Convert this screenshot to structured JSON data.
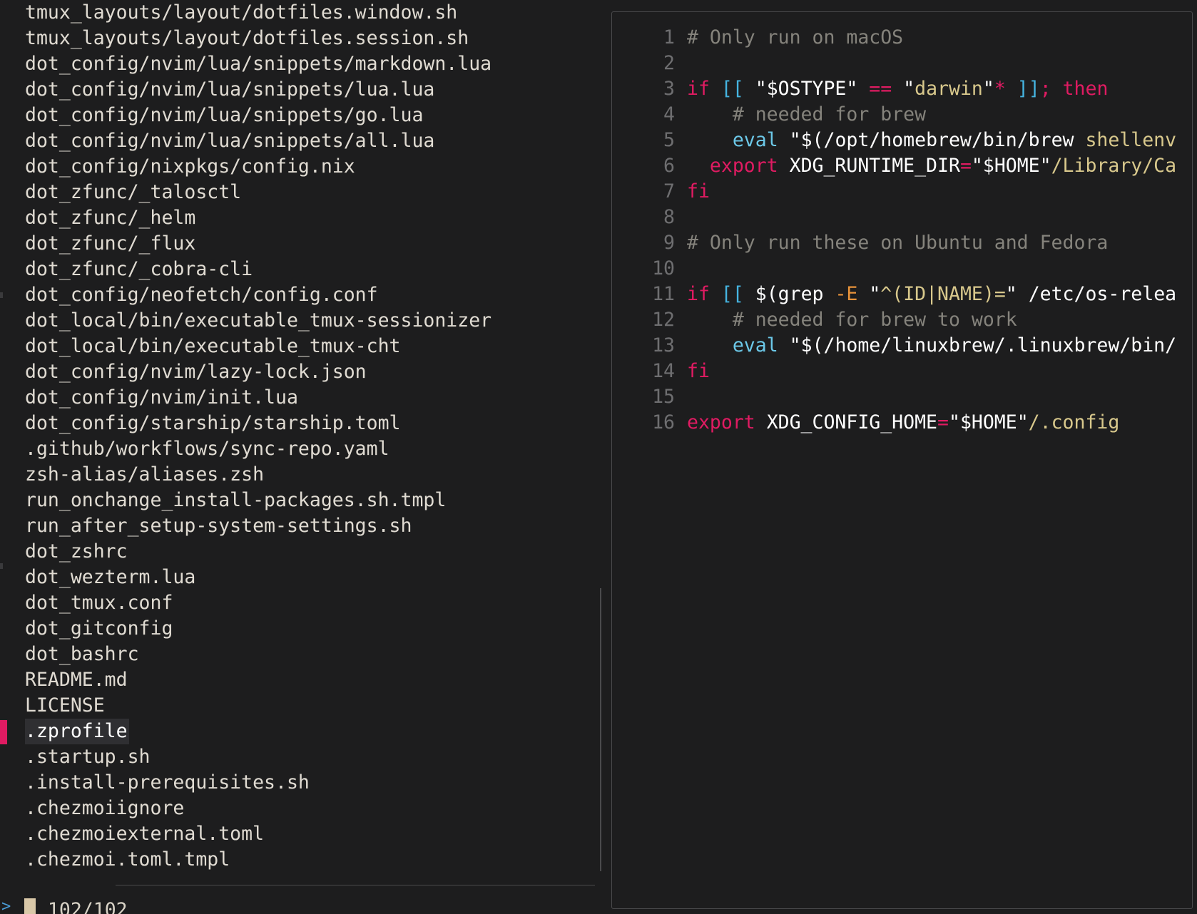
{
  "file_list": {
    "items": [
      "tmux_layouts/layout/dotfiles.window.sh",
      "tmux_layouts/layout/dotfiles.session.sh",
      "dot_config/nvim/lua/snippets/markdown.lua",
      "dot_config/nvim/lua/snippets/lua.lua",
      "dot_config/nvim/lua/snippets/go.lua",
      "dot_config/nvim/lua/snippets/all.lua",
      "dot_config/nixpkgs/config.nix",
      "dot_zfunc/_talosctl",
      "dot_zfunc/_helm",
      "dot_zfunc/_flux",
      "dot_zfunc/_cobra-cli",
      "dot_config/neofetch/config.conf",
      "dot_local/bin/executable_tmux-sessionizer",
      "dot_local/bin/executable_tmux-cht",
      "dot_config/nvim/lazy-lock.json",
      "dot_config/nvim/init.lua",
      "dot_config/starship/starship.toml",
      ".github/workflows/sync-repo.yaml",
      "zsh-alias/aliases.zsh",
      "run_onchange_install-packages.sh.tmpl",
      "run_after_setup-system-settings.sh",
      "dot_zshrc",
      "dot_wezterm.lua",
      "dot_tmux.conf",
      "dot_gitconfig",
      "dot_bashrc",
      "README.md",
      "LICENSE",
      ".zprofile",
      ".startup.sh",
      ".install-prerequisites.sh",
      ".chezmoiignore",
      ".chezmoiexternal.toml",
      ".chezmoi.toml.tmpl"
    ],
    "selected": ".zprofile",
    "count": "102/102"
  },
  "prompt": {
    "glyph": ">"
  },
  "preview": {
    "file": ".zprofile",
    "lines": [
      {
        "n": "1",
        "tokens": [
          {
            "t": "# Only run on macOS",
            "c": "comment"
          }
        ]
      },
      {
        "n": "2",
        "tokens": []
      },
      {
        "n": "3",
        "tokens": [
          {
            "t": "if ",
            "c": "kw"
          },
          {
            "t": "[[ ",
            "c": "bracket"
          },
          {
            "t": "\"$OSTYPE\" ",
            "c": "plain"
          },
          {
            "t": "== ",
            "c": "op"
          },
          {
            "t": "\"",
            "c": "plain"
          },
          {
            "t": "darwin",
            "c": "str"
          },
          {
            "t": "\"",
            "c": "plain"
          },
          {
            "t": "* ",
            "c": "op"
          },
          {
            "t": "]]",
            "c": "bracket"
          },
          {
            "t": "; then",
            "c": "kw"
          }
        ]
      },
      {
        "n": "4",
        "tokens": [
          {
            "t": "    # needed for brew",
            "c": "comment"
          }
        ]
      },
      {
        "n": "5",
        "tokens": [
          {
            "t": "    ",
            "c": "plain"
          },
          {
            "t": "eval ",
            "c": "builtin"
          },
          {
            "t": "\"$(",
            "c": "plain"
          },
          {
            "t": "/opt/homebrew/bin/brew ",
            "c": "plain"
          },
          {
            "t": "shellenv",
            "c": "str"
          }
        ]
      },
      {
        "n": "6",
        "tokens": [
          {
            "t": "  ",
            "c": "plain"
          },
          {
            "t": "export ",
            "c": "kw"
          },
          {
            "t": "XDG_RUNTIME_DIR",
            "c": "plain"
          },
          {
            "t": "=",
            "c": "op"
          },
          {
            "t": "\"$HOME\"",
            "c": "plain"
          },
          {
            "t": "/Library/Ca",
            "c": "str"
          }
        ]
      },
      {
        "n": "7",
        "tokens": [
          {
            "t": "fi",
            "c": "kw"
          }
        ]
      },
      {
        "n": "8",
        "tokens": []
      },
      {
        "n": "9",
        "tokens": [
          {
            "t": "# Only run these on Ubuntu and Fedora",
            "c": "comment"
          }
        ]
      },
      {
        "n": "10",
        "tokens": []
      },
      {
        "n": "11",
        "tokens": [
          {
            "t": "if ",
            "c": "kw"
          },
          {
            "t": "[[ ",
            "c": "bracket"
          },
          {
            "t": "$(grep ",
            "c": "plain"
          },
          {
            "t": "-E ",
            "c": "flag"
          },
          {
            "t": "\"",
            "c": "plain"
          },
          {
            "t": "^(ID|NAME)=",
            "c": "str"
          },
          {
            "t": "\" /etc/os-relea",
            "c": "plain"
          }
        ]
      },
      {
        "n": "12",
        "tokens": [
          {
            "t": "    # needed for brew to work",
            "c": "comment"
          }
        ]
      },
      {
        "n": "13",
        "tokens": [
          {
            "t": "    ",
            "c": "plain"
          },
          {
            "t": "eval ",
            "c": "builtin"
          },
          {
            "t": "\"$(",
            "c": "plain"
          },
          {
            "t": "/home/linuxbrew/.linuxbrew/bin/",
            "c": "plain"
          }
        ]
      },
      {
        "n": "14",
        "tokens": [
          {
            "t": "fi",
            "c": "kw"
          }
        ]
      },
      {
        "n": "15",
        "tokens": []
      },
      {
        "n": "16",
        "tokens": [
          {
            "t": "export ",
            "c": "kw"
          },
          {
            "t": "XDG_CONFIG_HOME",
            "c": "plain"
          },
          {
            "t": "=",
            "c": "op"
          },
          {
            "t": "\"$HOME\"",
            "c": "plain"
          },
          {
            "t": "/.config",
            "c": "str"
          }
        ]
      }
    ]
  },
  "colors": {
    "background": "#1d1d1e",
    "selection_marker": "#e01b62",
    "keyword": "#e01b62",
    "bracket": "#45b4e0",
    "string": "#d8c88c",
    "comment": "#85837c",
    "flag": "#e8933a"
  }
}
